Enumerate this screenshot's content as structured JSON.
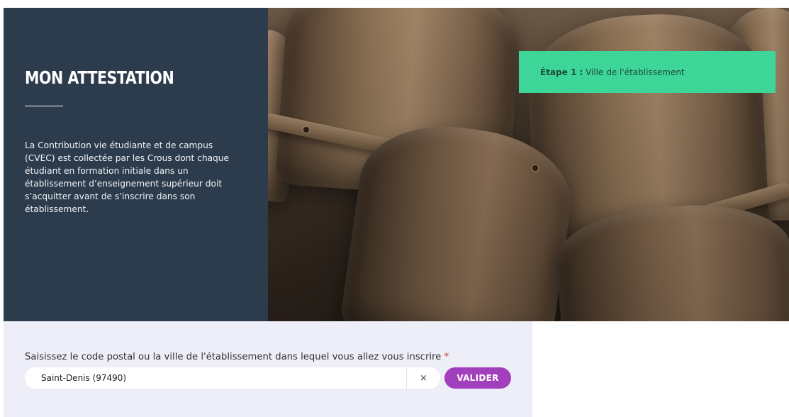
{
  "intro": {
    "title": "MON ATTESTATION",
    "description": "La Contribution vie étudiante et de campus (CVEC) est collectée par les Crous dont chaque étudiant en formation initiale dans un établissement d’enseignement supérieur doit s’acquitter avant de s’inscrire dans son établissement."
  },
  "step": {
    "number_label": "Étape 1 :",
    "title": "Ville de l'établissement"
  },
  "form": {
    "label": "Saisissez le code postal ou la ville de l'établissement dans lequel vous allez vous inscrire",
    "required_mark": "*",
    "search_value": "Saint-Denis (97490)",
    "clear_label": "×",
    "submit_label": "VALIDER"
  },
  "colors": {
    "panel_bg": "#2d3c4d",
    "step_banner_bg": "#3dd598",
    "form_bg": "#eeeef9",
    "submit_bg": "#a23fbd",
    "required": "#d62c2c"
  }
}
